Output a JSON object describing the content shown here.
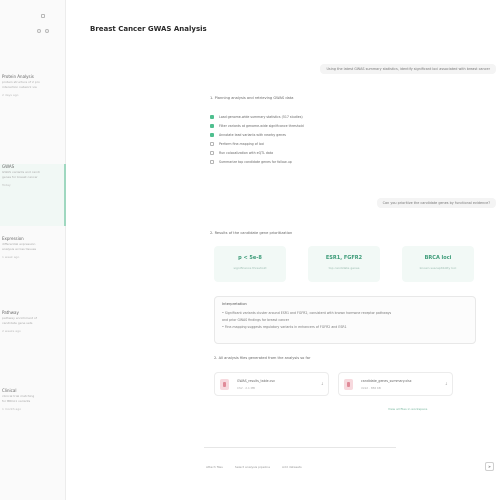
{
  "app": {
    "title": "Breast Cancer GWAS Analysis"
  },
  "sidebar": {
    "history": [
      {
        "title": "Protein Analysis",
        "subtitle_lines": [
          "protein structure of 2 pro",
          "interaction network via"
        ],
        "meta": "2 days ago",
        "active": false
      },
      {
        "title": "GWAS",
        "subtitle_lines": [
          "GWAS variants and candi",
          "genes for breast cancer"
        ],
        "meta": "Today",
        "active": true
      },
      {
        "title": "Expression",
        "subtitle_lines": [
          "differential expression",
          "analysis across tissues"
        ],
        "meta": "1 week ago",
        "active": false
      },
      {
        "title": "Pathway",
        "subtitle_lines": [
          "pathway enrichment of",
          "candidate gene sets"
        ],
        "meta": "2 weeks ago",
        "active": false
      },
      {
        "title": "Clinical",
        "subtitle_lines": [
          "clinical trial matching",
          "for BRCA1 variants"
        ],
        "meta": "1 month ago",
        "active": false
      }
    ]
  },
  "conversation": {
    "user_message_1": "Using the latest GWAS summary statistics, identify significant loci associated with breast cancer",
    "step_1": "1. Planning analysis and retrieving GWAS data",
    "checklist": [
      {
        "label": "Load genome-wide summary statistics (517 studies)",
        "done": true
      },
      {
        "label": "Filter variants at genome-wide significance threshold",
        "done": true
      },
      {
        "label": "Annotate lead variants with nearby genes",
        "done": true
      },
      {
        "label": "Perform fine-mapping of loci",
        "done": false
      },
      {
        "label": "Run colocalization with eQTL data",
        "done": false
      },
      {
        "label": "Summarize top candidate genes for follow-up",
        "done": false
      }
    ],
    "user_message_2": "Can you prioritize the candidate genes by functional evidence?",
    "step_2": "2. Results of the candidate gene prioritization",
    "stats": [
      {
        "value": "p < 5e-8",
        "label": "significance threshold"
      },
      {
        "value": "ESR1, FGFR2",
        "label": "top candidate genes"
      },
      {
        "value": "BRCA loci",
        "label": "known susceptibility loci"
      }
    ],
    "interpretation": {
      "heading": "Interpretation",
      "lines": [
        "• Significant variants cluster around ESR1 and FGFR2, consistent with known hormone receptor pathways",
        "  and prior GWAS findings for breast cancer",
        "• Fine-mapping suggests regulatory variants in enhancers of FGFR2 and ESR1"
      ]
    },
    "files_heading": "2. All analysis files generated from the analysis so far",
    "files": [
      {
        "name": "GWAS_results_table.csv",
        "size": "CSV · 2.1 MB"
      },
      {
        "name": "candidate_genes_summary.xlsx",
        "size": "XLSX · 856 KB"
      }
    ],
    "view_all": "View all files in workspace"
  },
  "input_bar": {
    "chips": [
      "Attach files",
      "Select analysis pipeline",
      "Add datasets"
    ],
    "send_icon": "send-icon"
  }
}
